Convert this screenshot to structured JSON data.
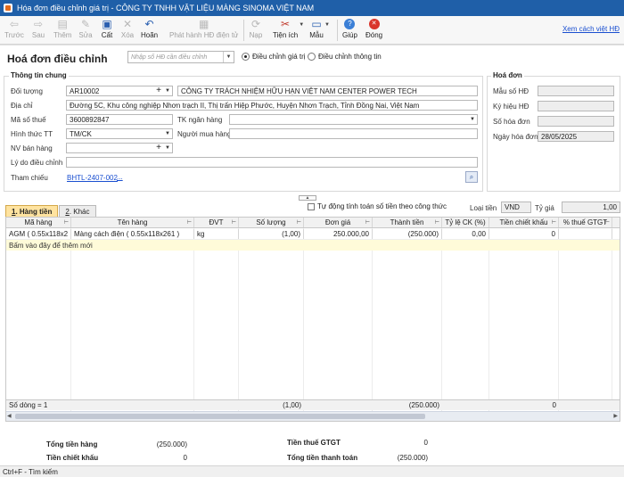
{
  "window": {
    "title": "Hóa đơn điều chỉnh giá trị - CÔNG TY TNHH VẬT LIỆU MÀNG SINOMA VIỆT NAM"
  },
  "toolbar": {
    "prev": "Trước",
    "next": "Sau",
    "add": "Thêm",
    "edit": "Sửa",
    "save": "Cất",
    "delete": "Xóa",
    "undo": "Hoãn",
    "publish": "Phát hành HĐ điện tử",
    "load": "Nạp",
    "utility": "Tiện ích",
    "template": "Mẫu",
    "help": "Giúp",
    "close": "Đóng",
    "help_link": "Xem cách việt HĐ"
  },
  "form": {
    "heading": "Hoá đơn điều chỉnh",
    "search_placeholder": "Nhập số HĐ cần điều chỉnh",
    "radio_value": "Điều chỉnh giá trị",
    "radio_info": "Điều chỉnh thông tin"
  },
  "general": {
    "group_title": "Thông tin chung",
    "object_label": "Đối tượng",
    "object_code": "AR10002",
    "object_name": "CÔNG TY TRÁCH NHIỆM HỮU HẠN VIỆT NAM CENTER POWER TECH",
    "address_label": "Địa chỉ",
    "address": "Đường 5C, Khu công nghiệp Nhơn trạch II, Thị trấn Hiệp Phước, Huyện Nhơn Trạch, Tỉnh Đồng Nai, Việt Nam",
    "tax_label": "Mã số thuế",
    "tax_code": "3600892847",
    "bank_label": "TK ngân hàng",
    "bank": "",
    "payment_label": "Hình thức TT",
    "payment": "TM/CK",
    "buyer_label": "Người mua hàng",
    "buyer": "",
    "staff_label": "NV bán hàng",
    "staff": "",
    "reason_label": "Lý do điều chỉnh",
    "reason": "",
    "ref_label": "Tham chiếu",
    "ref": "BHTL-2407-002",
    "ref_more": "..."
  },
  "invoice": {
    "group_title": "Hoá đơn",
    "template_label": "Mẫu số HĐ",
    "template": "",
    "symbol_label": "Ký hiệu HĐ",
    "symbol": "",
    "number_label": "Số hóa đơn",
    "number": "",
    "date_label": "Ngày hóa đơn",
    "date": "28/05/2025"
  },
  "tabs": {
    "goods": "Hàng tiền",
    "goods_key": "1",
    "other": "Khác",
    "other_key": "2"
  },
  "options": {
    "auto_calc": "Tự động tính toán số tiền theo công thức",
    "currency_label": "Loại tiền",
    "currency": "VND",
    "rate_label": "Tỷ giá",
    "rate": "1,00"
  },
  "grid": {
    "columns": [
      "Mã hàng",
      "Tên hàng",
      "ĐVT",
      "Số lượng",
      "Đơn giá",
      "Thành tiền",
      "Tỷ lệ CK (%)",
      "Tiền chiết khấu",
      "% thuế GTGT"
    ],
    "rows": [
      [
        "AGM ( 0.55x118x2",
        "Màng cách điện ( 0.55x118x261 )",
        "kg",
        "(1,00)",
        "250.000,00",
        "(250.000)",
        "0,00",
        "0",
        ""
      ]
    ],
    "new_row_hint": "Bấm vào đây để thêm mới",
    "footer": {
      "count": "Số dòng = 1",
      "qty": "(1,00)",
      "amount": "(250.000)",
      "discount": "0"
    }
  },
  "totals": {
    "goods_label": "Tổng tiền hàng",
    "goods": "(250.000)",
    "discount_label": "Tiền chiết khấu",
    "discount": "0",
    "vat_label": "Tiền thuế GTGT",
    "vat": "0",
    "total_label": "Tổng tiền thanh toán",
    "total": "(250.000)"
  },
  "status": {
    "hint": "Ctrl+F - Tìm kiếm"
  }
}
